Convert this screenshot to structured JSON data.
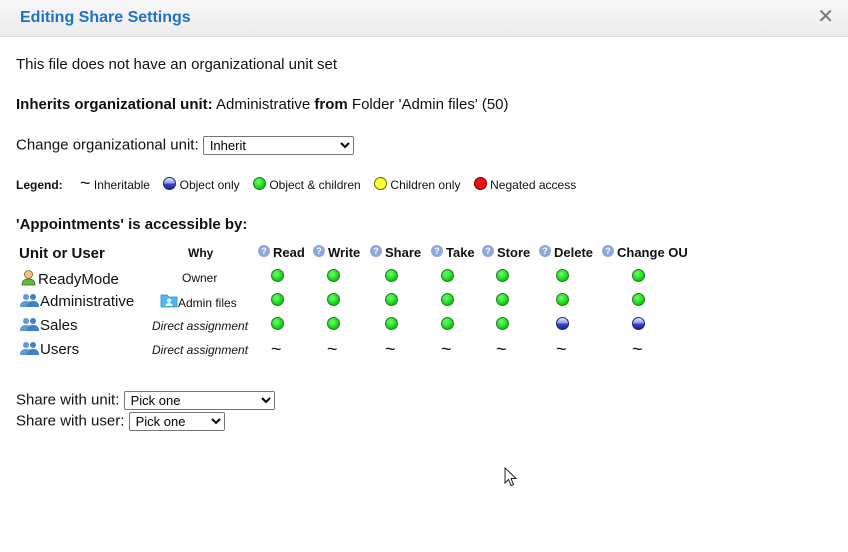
{
  "dialog": {
    "title": "Editing Share Settings"
  },
  "info": {
    "no_ou_text": "This file does not have an organizational unit set",
    "inherits_label": "Inherits organizational unit:",
    "inherits_unit": "Administrative",
    "from_label": "from",
    "from_folder": "Folder 'Admin files' (50)"
  },
  "change_ou": {
    "label": "Change organizational unit:",
    "selected": "Inherit"
  },
  "legend": {
    "label": "Legend:",
    "inheritable": "Inheritable",
    "object_only": "Object only",
    "object_children": "Object & children",
    "children_only": "Children only",
    "negated": "Negated access"
  },
  "access": {
    "heading": "'Appointments' is accessible by:",
    "columns": {
      "unit": "Unit or User",
      "why": "Why",
      "read": "Read",
      "write": "Write",
      "share": "Share",
      "take": "Take",
      "store": "Store",
      "delete": "Delete",
      "change_ou": "Change OU"
    },
    "rows": [
      {
        "name": "ReadyMode",
        "icon": "user-icon",
        "why": "Owner",
        "perms": [
          "green",
          "green",
          "green",
          "green",
          "green",
          "green",
          "green"
        ]
      },
      {
        "name": "Administrative",
        "icon": "group-icon",
        "why": "Admin files",
        "perms": [
          "green",
          "green",
          "green",
          "green",
          "green",
          "green",
          "green"
        ]
      },
      {
        "name": "Sales",
        "icon": "group-icon",
        "why": "Direct assignment",
        "perms": [
          "green",
          "green",
          "green",
          "green",
          "green",
          "blue",
          "blue"
        ]
      },
      {
        "name": "Users",
        "icon": "group-icon",
        "why": "Direct assignment",
        "perms": [
          "tilde",
          "tilde",
          "tilde",
          "tilde",
          "tilde",
          "tilde",
          "tilde"
        ]
      }
    ]
  },
  "share_unit": {
    "label": "Share with unit:",
    "selected": "Pick one"
  },
  "share_user": {
    "label": "Share with user:",
    "selected": "Pick one"
  }
}
